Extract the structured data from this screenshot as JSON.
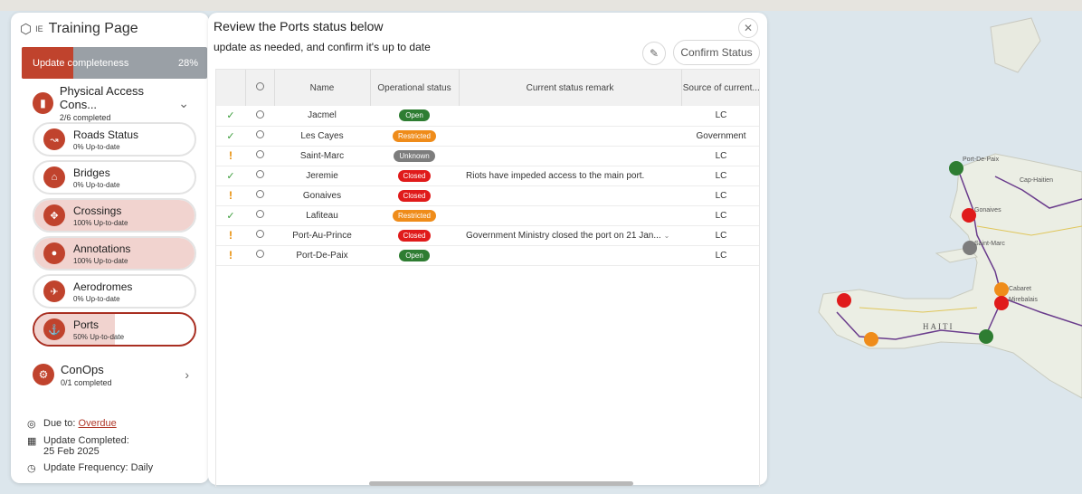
{
  "app": {
    "title": "Training Page",
    "logo_sub": "IE"
  },
  "completeness": {
    "label": "Update completeness",
    "percent_text": "28%",
    "fraction": 0.28
  },
  "section": {
    "title": "Physical Access Cons...",
    "subtitle": "2/6 completed",
    "icon": "door-icon"
  },
  "items": [
    {
      "title": "Roads Status",
      "subtitle": "0% Up-to-date",
      "icon": "road-icon",
      "fraction": 0.0,
      "active": false
    },
    {
      "title": "Bridges",
      "subtitle": "0% Up-to-date",
      "icon": "bridge-icon",
      "fraction": 0.0,
      "active": false
    },
    {
      "title": "Crossings",
      "subtitle": "100% Up-to-date",
      "icon": "crossing-icon",
      "fraction": 1.0,
      "active": false
    },
    {
      "title": "Annotations",
      "subtitle": "100% Up-to-date",
      "icon": "pin-icon",
      "fraction": 1.0,
      "active": false
    },
    {
      "title": "Aerodromes",
      "subtitle": "0% Up-to-date",
      "icon": "plane-icon",
      "fraction": 0.0,
      "active": false
    },
    {
      "title": "Ports",
      "subtitle": "50% Up-to-date",
      "icon": "anchor-icon",
      "fraction": 0.5,
      "active": true
    }
  ],
  "conops": {
    "title": "ConOps",
    "subtitle": "0/1 completed"
  },
  "footer": {
    "due_label": "Due to:",
    "due_value": "Overdue",
    "completed_label": "Update Completed:",
    "completed_value": "25 Feb 2025",
    "frequency_label": "Update Frequency:",
    "frequency_value": "Daily"
  },
  "main": {
    "title": "Review the Ports status below",
    "subtitle": "update as needed, and confirm it's up to date",
    "confirm_label": "Confirm Status"
  },
  "table": {
    "headers": [
      "Name",
      "Operational status",
      "Current status remark",
      "Source of current..."
    ],
    "rows": [
      {
        "flag": "check",
        "name": "Jacmel",
        "status": "Open",
        "remark": "",
        "source": "LC"
      },
      {
        "flag": "check",
        "name": "Les Cayes",
        "status": "Restricted",
        "remark": "",
        "source": "Government"
      },
      {
        "flag": "warn",
        "name": "Saint-Marc",
        "status": "Unknown",
        "remark": "",
        "source": "LC"
      },
      {
        "flag": "check",
        "name": "Jeremie",
        "status": "Closed",
        "remark": "Riots have impeded access to the main port.",
        "source": "LC"
      },
      {
        "flag": "warn",
        "name": "Gonaives",
        "status": "Closed",
        "remark": "",
        "source": "LC"
      },
      {
        "flag": "check",
        "name": "Lafiteau",
        "status": "Restricted",
        "remark": "",
        "source": "LC"
      },
      {
        "flag": "warn",
        "name": "Port-Au-Prince",
        "status": "Closed",
        "remark": "Government Ministry closed the port on 21 Jan...",
        "source": "LC"
      },
      {
        "flag": "warn",
        "name": "Port-De-Paix",
        "status": "Open",
        "remark": "",
        "source": "LC"
      }
    ]
  },
  "status_colors": {
    "Open": "#2e7d32",
    "Restricted": "#ef8c1a",
    "Unknown": "#7d7d7d",
    "Closed": "#e01b1b"
  },
  "map": {
    "country_label": "HAITI",
    "labels": [
      "Port-De-Paix",
      "Cap-Haitien",
      "Gonaives",
      "Saint-Marc",
      "Cabaret",
      "Mirebalais"
    ]
  }
}
